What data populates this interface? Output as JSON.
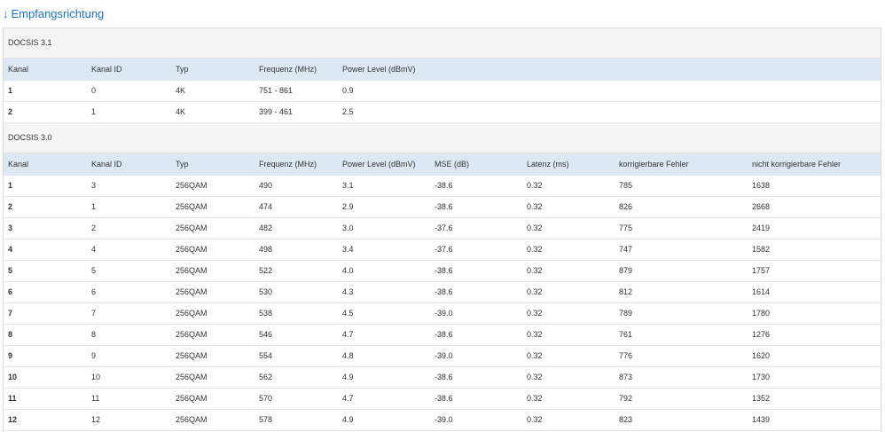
{
  "heading": {
    "arrow": "↓",
    "title": "Empfangsrichtung"
  },
  "docsis31": {
    "title": "DOCSIS 3.1",
    "columns": [
      "Kanal",
      "Kanal ID",
      "Typ",
      "Frequenz (MHz)",
      "Power Level (dBmV)"
    ],
    "rows": [
      [
        "1",
        "0",
        "4K",
        "751 - 861",
        "0.9"
      ],
      [
        "2",
        "1",
        "4K",
        "399 - 461",
        "2.5"
      ]
    ]
  },
  "docsis30": {
    "title": "DOCSIS 3.0",
    "columns": [
      "Kanal",
      "Kanal ID",
      "Typ",
      "Frequenz (MHz)",
      "Power Level (dBmV)",
      "MSE (dB)",
      "Latenz (ms)",
      "korrigierbare Fehler",
      "nicht korrigierbare Fehler"
    ],
    "rows": [
      [
        "1",
        "3",
        "256QAM",
        "490",
        "3.1",
        "-38.6",
        "0.32",
        "785",
        "1638"
      ],
      [
        "2",
        "1",
        "256QAM",
        "474",
        "2.9",
        "-38.6",
        "0.32",
        "826",
        "2668"
      ],
      [
        "3",
        "2",
        "256QAM",
        "482",
        "3.0",
        "-37.6",
        "0.32",
        "775",
        "2419"
      ],
      [
        "4",
        "4",
        "256QAM",
        "498",
        "3.4",
        "-37.6",
        "0.32",
        "747",
        "1582"
      ],
      [
        "5",
        "5",
        "256QAM",
        "522",
        "4.0",
        "-38.6",
        "0.32",
        "879",
        "1757"
      ],
      [
        "6",
        "6",
        "256QAM",
        "530",
        "4.3",
        "-38.6",
        "0.32",
        "812",
        "1614"
      ],
      [
        "7",
        "7",
        "256QAM",
        "538",
        "4.5",
        "-39.0",
        "0.32",
        "789",
        "1780"
      ],
      [
        "8",
        "8",
        "256QAM",
        "546",
        "4.7",
        "-38.6",
        "0.32",
        "761",
        "1276"
      ],
      [
        "9",
        "9",
        "256QAM",
        "554",
        "4.8",
        "-39.0",
        "0.32",
        "776",
        "1620"
      ],
      [
        "10",
        "10",
        "256QAM",
        "562",
        "4.9",
        "-38.6",
        "0.32",
        "873",
        "1730"
      ],
      [
        "11",
        "11",
        "256QAM",
        "570",
        "4.7",
        "-38.6",
        "0.32",
        "792",
        "1352"
      ],
      [
        "12",
        "12",
        "256QAM",
        "578",
        "4.9",
        "-39.0",
        "0.32",
        "823",
        "1439"
      ]
    ]
  }
}
